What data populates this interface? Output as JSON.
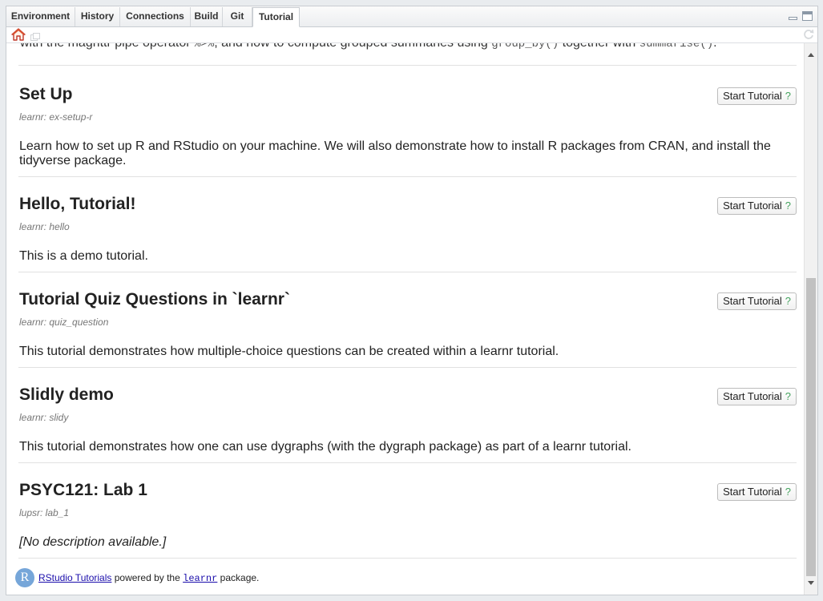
{
  "tabs": [
    {
      "label": "Environment",
      "active": false
    },
    {
      "label": "History",
      "active": false
    },
    {
      "label": "Connections",
      "active": false
    },
    {
      "label": "Build",
      "active": false
    },
    {
      "label": "Git",
      "active": false
    },
    {
      "label": "Tutorial",
      "active": true
    }
  ],
  "toolbar": {
    "home_icon": "home-icon",
    "popout_icon": "popout-icon",
    "refresh_icon": "refresh-icon"
  },
  "overflow_text": {
    "before": "with the magrittr pipe operator ",
    "pipe": "%>%",
    "middle": ", and how to compute grouped summaries using ",
    "group_by": "group_by()",
    "together": " together with ",
    "summarise": "summarise()",
    "end": "."
  },
  "tutorials": [
    {
      "title": "Set Up",
      "id": "learnr: ex-setup-r",
      "description": "Learn how to set up R and RStudio on your machine. We will also demonstrate how to install R packages from CRAN, and install the tidyverse package.",
      "button": "Start Tutorial",
      "help": "?"
    },
    {
      "title": "Hello, Tutorial!",
      "id": "learnr: hello",
      "description": "This is a demo tutorial.",
      "button": "Start Tutorial",
      "help": "?"
    },
    {
      "title": "Tutorial Quiz Questions in `learnr`",
      "id": "learnr: quiz_question",
      "description": "This tutorial demonstrates how multiple-choice questions can be created within a learnr tutorial.",
      "button": "Start Tutorial",
      "help": "?"
    },
    {
      "title": "Slidly demo",
      "id": "learnr: slidy",
      "description": "This tutorial demonstrates how one can use dygraphs (with the dygraph package) as part of a learnr tutorial.",
      "button": "Start Tutorial",
      "help": "?"
    },
    {
      "title": "PSYC121: Lab 1",
      "id": "lupsr: lab_1",
      "description": "[No description available.]",
      "button": "Start Tutorial",
      "help": "?"
    }
  ],
  "footer": {
    "logo_letter": "R",
    "link_text": "RStudio Tutorials",
    "powered_by": " powered by the ",
    "package": "learnr",
    "suffix": " package."
  },
  "colors": {
    "link": "#1a0dab",
    "help_mark": "#44a35e",
    "logo": "#76a6d9"
  }
}
